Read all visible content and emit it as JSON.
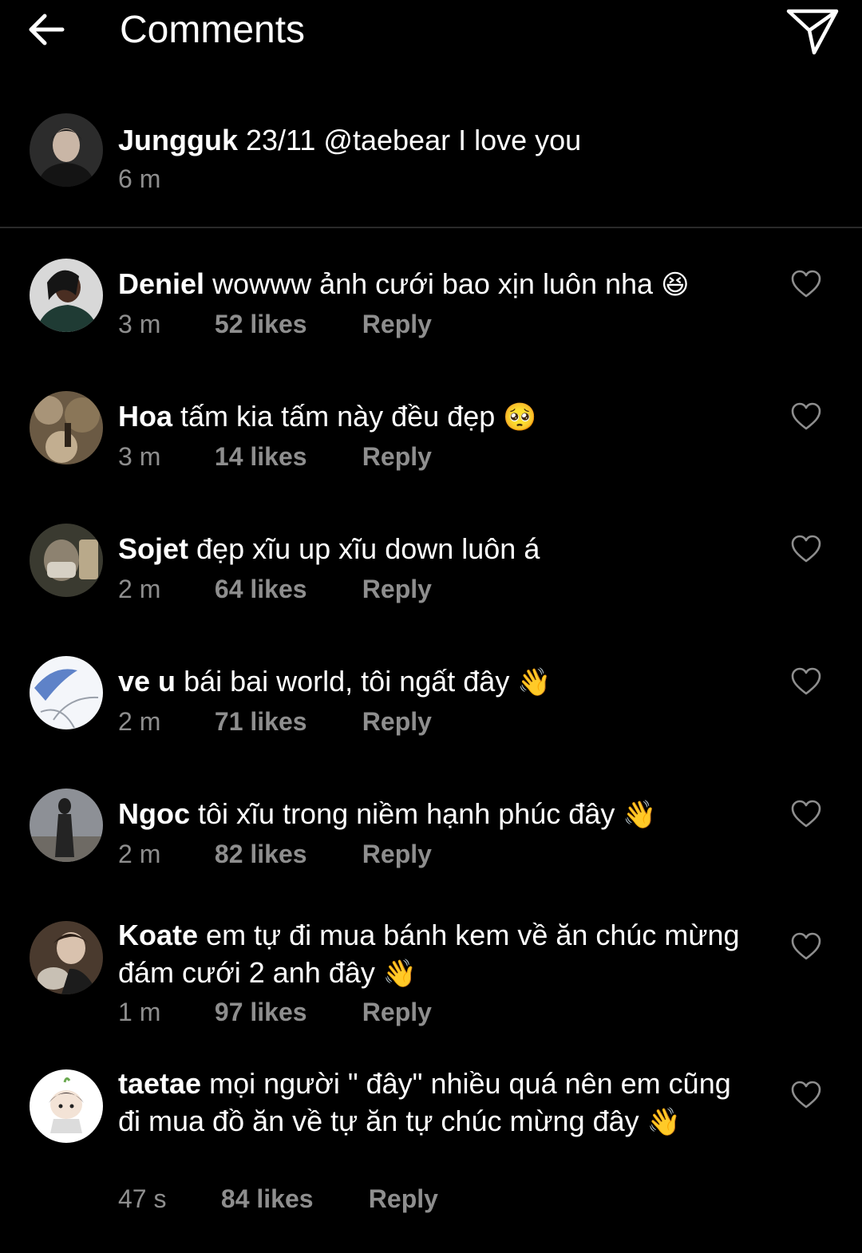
{
  "header": {
    "title": "Comments",
    "back_icon": "arrow-left-icon",
    "send_icon": "paper-plane-icon"
  },
  "caption": {
    "user": "Jungguk",
    "text": "23/11 @taebear I love you",
    "time": "6 m"
  },
  "reply_label": "Reply",
  "comments": [
    {
      "user": "Deniel",
      "text": "wowww ảnh cưới bao xịn luôn nha",
      "emoji": "😆",
      "time": "3 m",
      "likes": "52 likes"
    },
    {
      "user": "Hoa",
      "text": "tấm kia tấm này đều đẹp",
      "emoji": "🥺",
      "time": "3 m",
      "likes": "14 likes"
    },
    {
      "user": "Sojet",
      "text": "đẹp xĩu up xĩu down luôn á",
      "emoji": "",
      "time": "2 m",
      "likes": "64 likes"
    },
    {
      "user": "ve u",
      "text": "bái bai world, tôi ngất đây",
      "emoji": "👋",
      "time": "2 m",
      "likes": "71 likes"
    },
    {
      "user": "Ngoc",
      "text": "tôi xĩu trong niềm hạnh phúc đây",
      "emoji": "👋",
      "time": "2 m",
      "likes": "82 likes"
    },
    {
      "user": "Koate",
      "text": "em tự đi mua bánh kem về ăn chúc mừng đám cưới 2 anh đây",
      "emoji": "👋",
      "time": "1 m",
      "likes": "97 likes"
    },
    {
      "user": "taetae",
      "text": "mọi người \" đây\" nhiều quá nên em cũng đi mua đồ ăn về tự ăn tự chúc mừng đây",
      "emoji": "👋",
      "time": "47 s",
      "likes": "84 likes"
    }
  ],
  "colors": {
    "background": "#000000",
    "text": "#ffffff",
    "meta": "#8e8e8e",
    "divider": "#2a2a2a"
  }
}
